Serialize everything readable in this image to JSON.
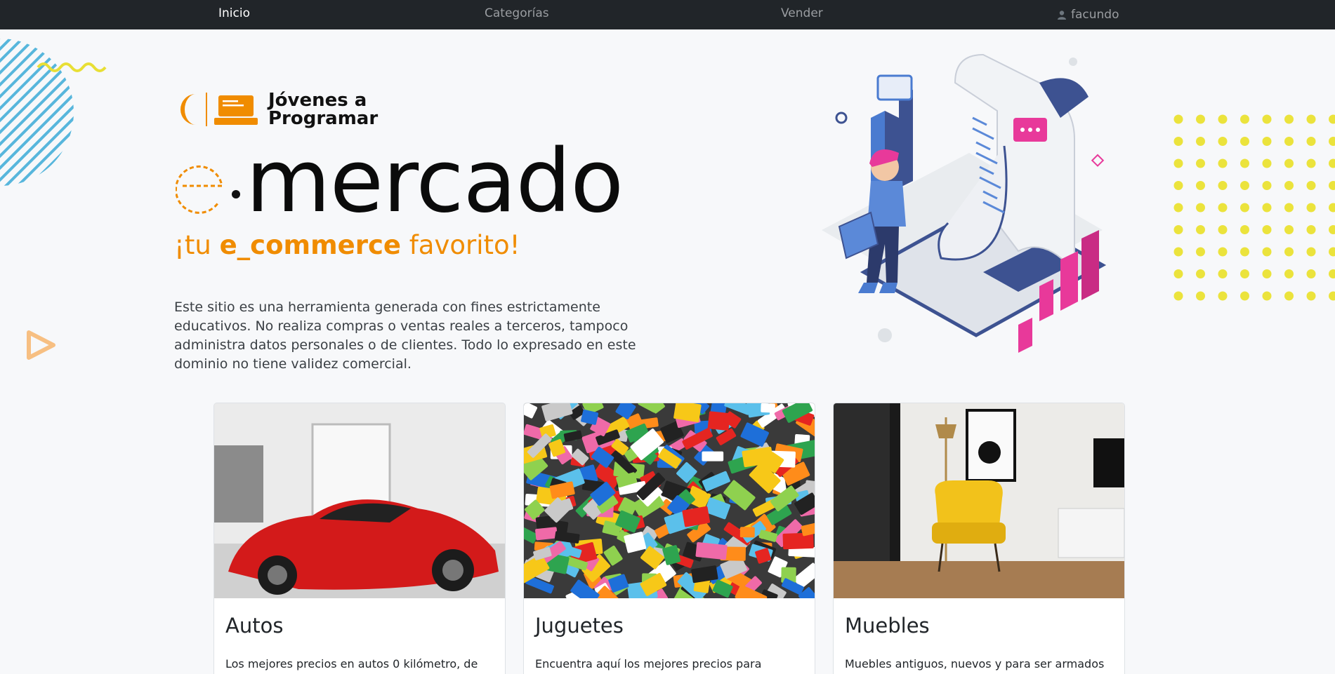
{
  "nav": {
    "items": [
      {
        "label": "Inicio",
        "active": true
      },
      {
        "label": "Categorías",
        "active": false
      },
      {
        "label": "Vender",
        "active": false
      }
    ],
    "user": {
      "name": "facundo",
      "icon": "user-icon"
    }
  },
  "hero": {
    "logo_line1": "Jóvenes a",
    "logo_line2": "Programar",
    "brand": "mercado",
    "tagline": {
      "pre": "¡tu ",
      "bold": "e_commerce",
      "post": " favorito!"
    },
    "disclaimer": "Este sitio es una herramienta generada con fines estrictamente educativos. No realiza compras o ventas reales a terceros, tampoco administra datos personales o de clientes. Todo lo expresado en este dominio no tiene validez comercial."
  },
  "cards": [
    {
      "title": "Autos",
      "text": "Los mejores precios en autos 0 kilómetro, de"
    },
    {
      "title": "Juguetes",
      "text": "Encuentra aquí los mejores precios para"
    },
    {
      "title": "Muebles",
      "text": "Muebles antiguos, nuevos y para ser armados"
    }
  ],
  "colors": {
    "accent": "#f08c00",
    "navbar": "#212529",
    "pink": "#e8399a",
    "blue": "#3d5291"
  }
}
